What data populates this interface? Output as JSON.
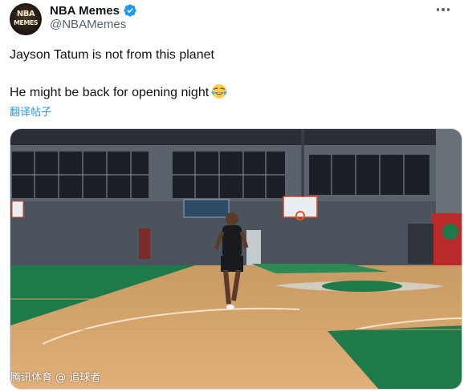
{
  "author": {
    "display_name": "NBA Memes",
    "handle": "@NBAMemes",
    "avatar_text_top": "NBA",
    "avatar_text_bottom": "MEMES",
    "verified_color": "#1d9bf0"
  },
  "tweet": {
    "line1": "Jayson Tatum is not from this planet",
    "line2": "He might be back for opening night",
    "emoji": "face-with-tears-of-joy-icon",
    "translate_label": "翻译帖子"
  },
  "media": {
    "watermark": "腾讯体育 @ 追球者",
    "description_colors": {
      "floor": "#d9a267",
      "paint_green": "#1f7a4a",
      "wall": "#4d5560"
    }
  },
  "menu": {
    "icon": "more-icon"
  }
}
